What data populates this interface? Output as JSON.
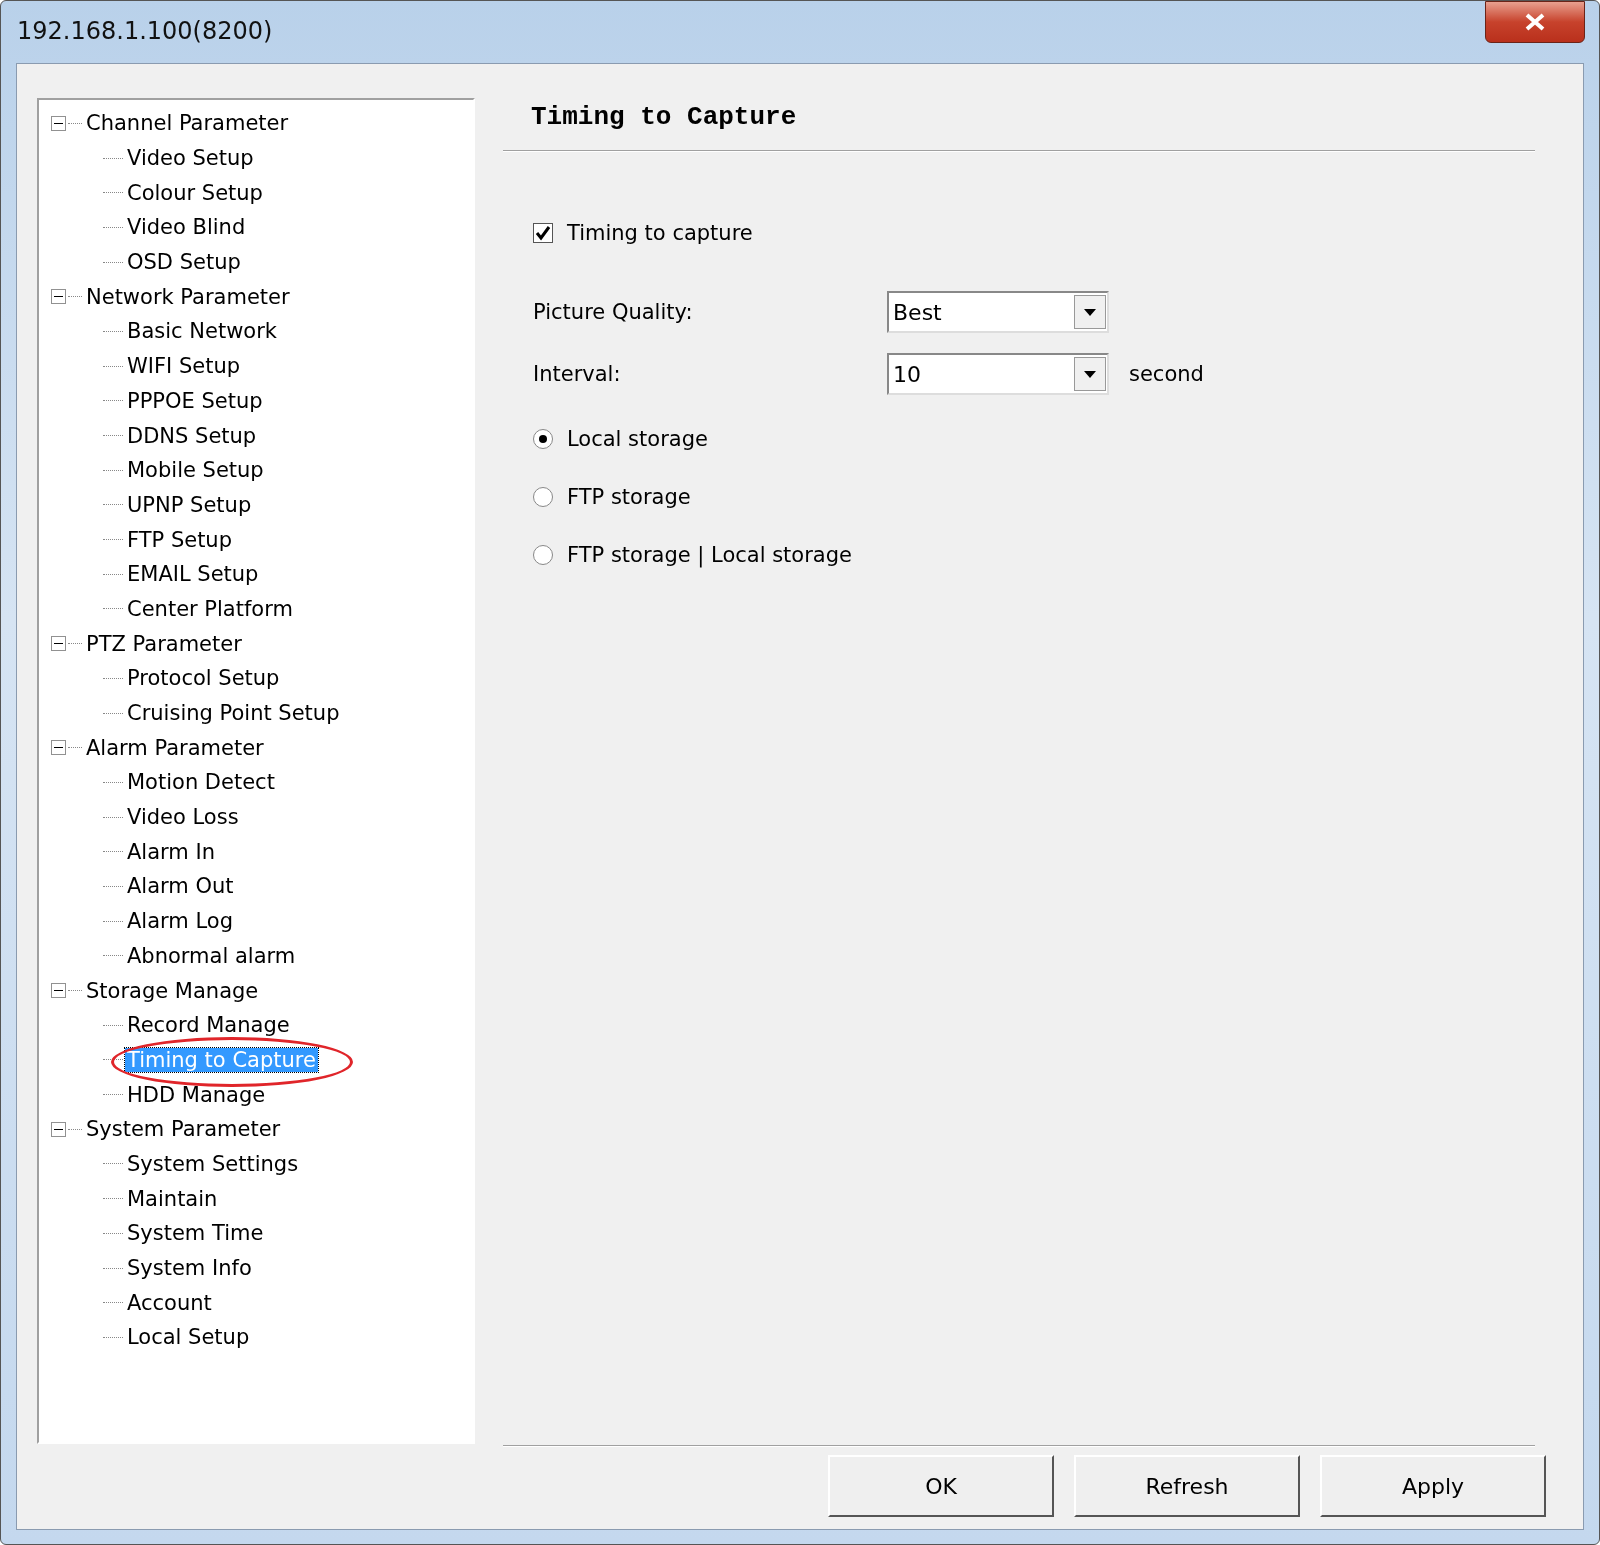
{
  "window": {
    "title": "192.168.1.100(8200)"
  },
  "tree": [
    {
      "label": "Channel Parameter",
      "expanded": true,
      "selected": false,
      "children": [
        {
          "label": "Video Setup",
          "selected": false
        },
        {
          "label": "Colour Setup",
          "selected": false
        },
        {
          "label": "Video Blind",
          "selected": false
        },
        {
          "label": "OSD Setup",
          "selected": false
        }
      ]
    },
    {
      "label": "Network Parameter",
      "expanded": true,
      "selected": false,
      "children": [
        {
          "label": "Basic Network",
          "selected": false
        },
        {
          "label": "WIFI Setup",
          "selected": false
        },
        {
          "label": "PPPOE Setup",
          "selected": false
        },
        {
          "label": "DDNS Setup",
          "selected": false
        },
        {
          "label": "Mobile Setup",
          "selected": false
        },
        {
          "label": "UPNP Setup",
          "selected": false
        },
        {
          "label": "FTP Setup",
          "selected": false
        },
        {
          "label": "EMAIL Setup",
          "selected": false
        },
        {
          "label": "Center Platform",
          "selected": false
        }
      ]
    },
    {
      "label": "PTZ Parameter",
      "expanded": true,
      "selected": false,
      "children": [
        {
          "label": "Protocol Setup",
          "selected": false
        },
        {
          "label": "Cruising Point Setup",
          "selected": false
        }
      ]
    },
    {
      "label": "Alarm Parameter",
      "expanded": true,
      "selected": false,
      "children": [
        {
          "label": "Motion Detect",
          "selected": false
        },
        {
          "label": "Video Loss",
          "selected": false
        },
        {
          "label": "Alarm In",
          "selected": false
        },
        {
          "label": "Alarm Out",
          "selected": false
        },
        {
          "label": "Alarm Log",
          "selected": false
        },
        {
          "label": "Abnormal alarm",
          "selected": false
        }
      ]
    },
    {
      "label": "Storage Manage",
      "expanded": true,
      "selected": false,
      "children": [
        {
          "label": "Record Manage",
          "selected": false
        },
        {
          "label": "Timing to Capture",
          "selected": true
        },
        {
          "label": "HDD Manage",
          "selected": false
        }
      ]
    },
    {
      "label": "System Parameter",
      "expanded": true,
      "selected": false,
      "children": [
        {
          "label": "System Settings",
          "selected": false
        },
        {
          "label": "Maintain",
          "selected": false
        },
        {
          "label": "System Time",
          "selected": false
        },
        {
          "label": "System Info",
          "selected": false
        },
        {
          "label": "Account",
          "selected": false
        },
        {
          "label": "Local Setup",
          "selected": false
        }
      ]
    }
  ],
  "annotation_circle_on_selected": true,
  "panel": {
    "heading": "Timing to Capture",
    "enable": {
      "label": "Timing to capture",
      "checked": true
    },
    "picture_quality": {
      "label": "Picture Quality:",
      "value": "Best"
    },
    "interval": {
      "label": "Interval:",
      "value": "10",
      "unit": "second"
    },
    "storage": [
      {
        "label": "Local storage",
        "selected": true
      },
      {
        "label": "FTP storage",
        "selected": false
      },
      {
        "label": "FTP storage | Local storage",
        "selected": false
      }
    ]
  },
  "buttons": [
    "OK",
    "Refresh",
    "Apply"
  ]
}
